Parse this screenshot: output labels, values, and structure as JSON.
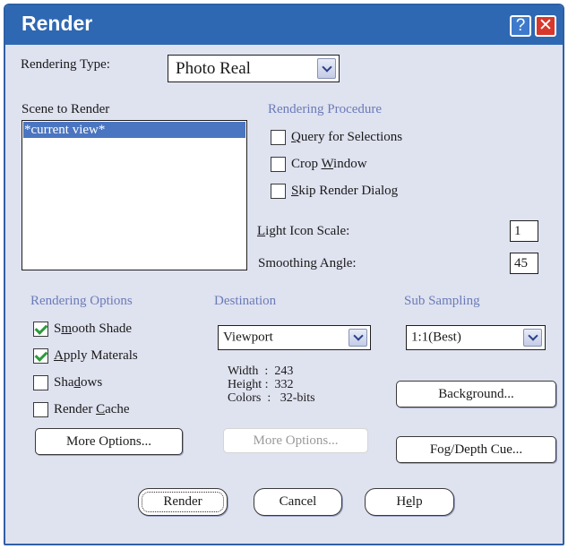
{
  "window": {
    "title": "Render"
  },
  "titlebar": {
    "help_icon": "?",
    "close_icon": "✕"
  },
  "rendering_type": {
    "label": "Rendering Type:",
    "value": "Photo Real"
  },
  "scene": {
    "label": "Scene to Render",
    "items": [
      "*current view*"
    ]
  },
  "procedure": {
    "label": "Rendering Procedure",
    "query_for_selections": {
      "pre": "",
      "u": "Q",
      "post": "uery for Selections",
      "checked": false
    },
    "crop_window": {
      "pre": "Crop ",
      "u": "W",
      "post": "indow",
      "checked": false
    },
    "skip_render_dialog": {
      "pre": "",
      "u": "S",
      "post": "kip Render Dialog",
      "checked": false
    }
  },
  "light_icon_scale": {
    "pre": "",
    "u": "L",
    "post": "ight Icon Scale:",
    "value": "1"
  },
  "smoothing_angle": {
    "label": "Smoothing Angle:",
    "value": "45"
  },
  "rendering_options": {
    "label": "Rendering Options",
    "smooth_shade": {
      "pre": "S",
      "u": "m",
      "post": "ooth Shade",
      "checked": true
    },
    "apply_materials": {
      "pre": "",
      "u": "A",
      "post": "pply Materals",
      "checked": true
    },
    "shadows": {
      "pre": "Sha",
      "u": "d",
      "post": "ows",
      "checked": false
    },
    "render_cache": {
      "pre": "Render ",
      "u": "C",
      "post": "ache",
      "checked": false
    },
    "more_options": "More Options..."
  },
  "destination": {
    "label": "Destination",
    "value": "Viewport",
    "width": "Width  :  243",
    "height": "Height :  332",
    "colors": "Colors  :   32-bits",
    "more_options": "More Options..."
  },
  "sub_sampling": {
    "label": "Sub Sampling",
    "value": "1:1(Best)",
    "background": "Background...",
    "fog": "Fog/Depth Cue..."
  },
  "footer": {
    "render": "Render",
    "cancel": "Cancel",
    "help": {
      "pre": "H",
      "u": "e",
      "post": "lp"
    }
  },
  "colors": {
    "titlebar": "#2f68b2",
    "dialog_bg": "#dfe2ef",
    "section_label": "#6a7bb8",
    "selection": "#4a75c0",
    "check": "#2d9a3c",
    "close": "#d8372b"
  }
}
